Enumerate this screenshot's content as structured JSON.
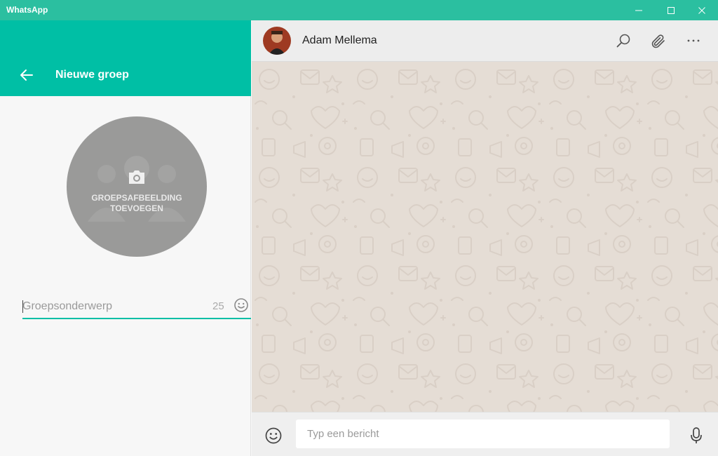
{
  "window": {
    "title": "WhatsApp"
  },
  "left_panel": {
    "header_title": "Nieuwe groep",
    "group_image_label": "GROEPSAFBEELDING TOEVOEGEN",
    "subject_placeholder": "Groepsonderwerp",
    "subject_value": "",
    "char_counter": "25"
  },
  "chat": {
    "contact_name": "Adam Mellema",
    "compose_placeholder": "Typ een bericht"
  },
  "colors": {
    "titlebar": "#2bbfa0",
    "accent": "#00bfa5",
    "chat_background": "#e5ddd5",
    "avatar_placeholder": "#9a9a99"
  },
  "icons": {
    "back": "arrow-left-icon",
    "camera": "camera-icon",
    "emoji": "smiley-icon",
    "search": "search-icon",
    "attach": "paperclip-icon",
    "menu": "more-horizontal-icon",
    "mic": "microphone-icon"
  }
}
